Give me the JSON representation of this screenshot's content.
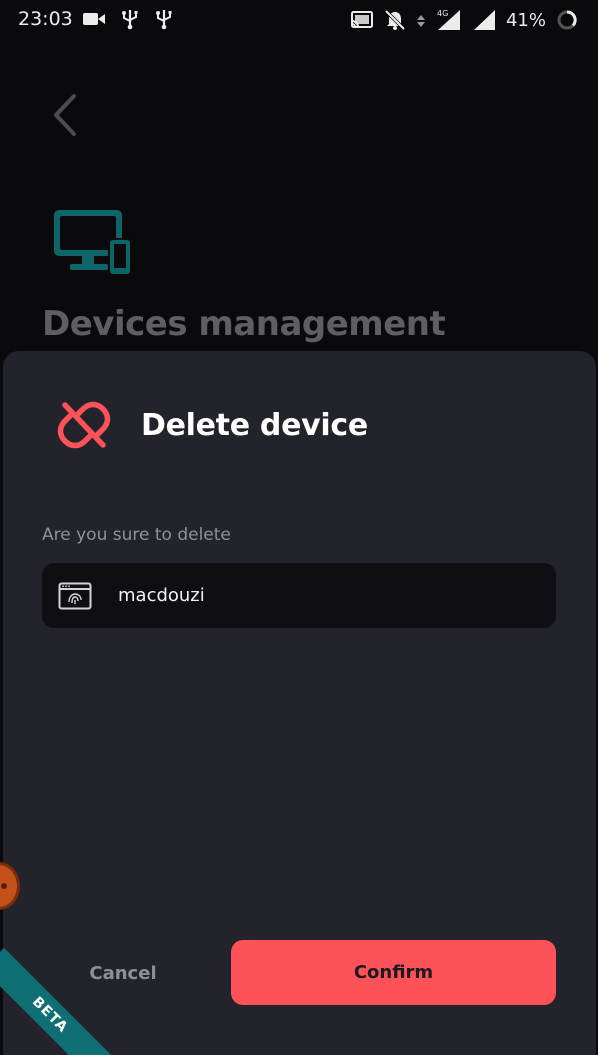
{
  "status_bar": {
    "time": "23:03",
    "battery_percent": "41%",
    "network_type": "4G",
    "left_icons": [
      "video-camera-icon",
      "usb-icon",
      "usb-icon"
    ],
    "right_icons": [
      "cast-icon",
      "notifications-off-icon",
      "data-arrows-icon",
      "signal-icon",
      "signal-icon",
      "battery-ring-icon"
    ]
  },
  "page": {
    "back_icon": "chevron-left-icon",
    "icon": "devices-icon",
    "title": "Devices management"
  },
  "sheet": {
    "icon": "unlink-icon",
    "title": "Delete device",
    "prompt": "Are you sure to delete",
    "device": {
      "icon": "browser-fingerprint-icon",
      "name": "macdouzi"
    },
    "cancel_label": "Cancel",
    "confirm_label": "Confirm"
  },
  "beta_label": "BETA",
  "colors": {
    "accent_red": "#fd5257",
    "teal": "#0f6f73",
    "sheet_bg": "#22232b",
    "card_bg": "#0e0e13"
  }
}
